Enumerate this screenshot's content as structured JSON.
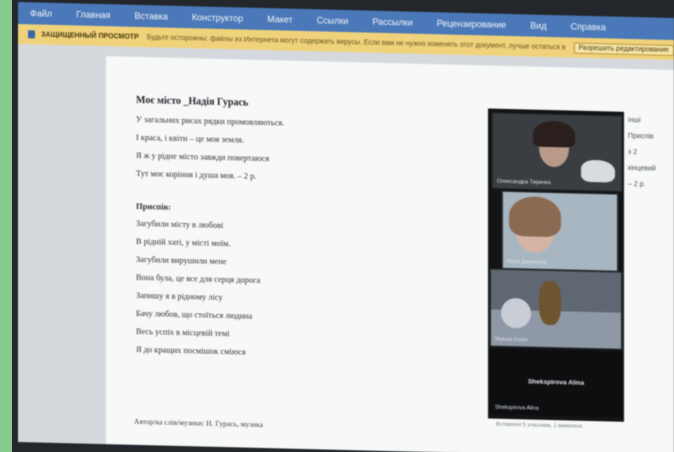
{
  "ribbon": {
    "tabs": [
      "Файл",
      "Главная",
      "Вставка",
      "Конструктор",
      "Макет",
      "Ссылки",
      "Рассылки",
      "Рецензирование",
      "Вид",
      "Справка"
    ]
  },
  "message_bar": {
    "title": "ЗАЩИЩЕННЫЙ ПРОСМОТР",
    "text": "Будьте осторожны: файлы из Интернета могут содержать вирусы. Если вам не нужно изменять этот документ, лучше остаться в режиме защищенного просмотра.",
    "enable_label": "Разрешить редактирование"
  },
  "document": {
    "title": "Моє місто _Надія Гурась",
    "verse_lines": [
      "У загальних рисах рядки промовляються.",
      "І краса, і квіти – це моя земля.",
      "Я ж у рідне місто завжди повертаюся",
      "Тут моє коріння і душа моя. – 2 р."
    ],
    "chorus_label": "Приспів:",
    "chorus_lines": [
      "Загубили місту в любові",
      "В рідній хаті, у місті моїм.",
      "Загубили вирушили мене",
      "Вона була, це все для серця дорога",
      "Запишу я в рідному лісу",
      "Бачу любов, що стоїться людина",
      "Весь успіх в місцевій темі",
      "Я до кращих посмішок сміюся"
    ],
    "footer_note": "Автор/ка слів/музики: Н. Гурась, музика"
  },
  "side_comments": [
    "інші",
    "Приспів",
    "з 2",
    "кінцевий",
    "– 2 р."
  ],
  "video_call": {
    "tiles": [
      {
        "name": "Олександра Тиринка"
      },
      {
        "name": "Юлія Данилова"
      },
      {
        "name": "Mykola Fedor"
      },
      {
        "name": "Shekspirova Alina",
        "center_label": "Shekspirova Alina"
      }
    ],
    "caption": "Вставлені 5 учасники, 1 вимкнено"
  },
  "colors": {
    "ribbon": "#4a78b8",
    "message_bar": "#efd27a",
    "page": "#f7f8f8",
    "video_bg": "#121416"
  }
}
